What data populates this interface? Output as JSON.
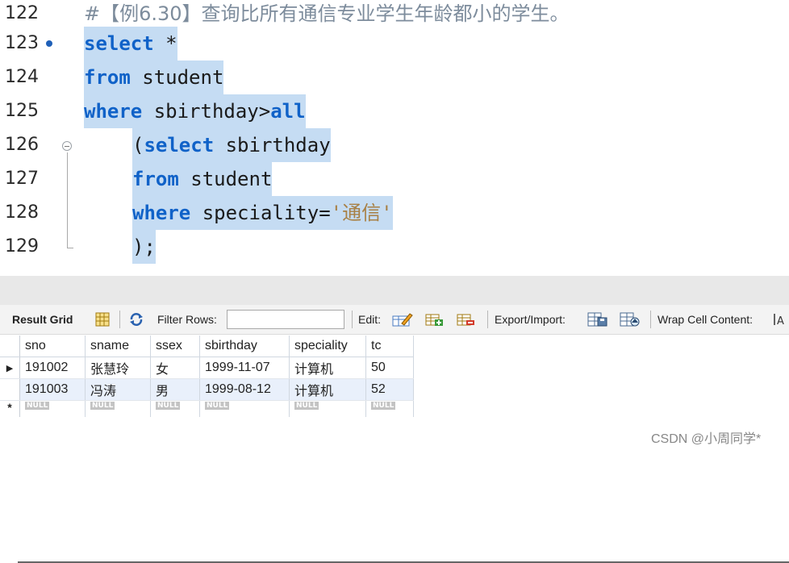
{
  "editor": {
    "lines": [
      {
        "num": "122",
        "parts": [
          {
            "t": "#【例6.30】查询比所有通信专业学生年龄都小的学生。",
            "c": "cm"
          }
        ]
      },
      {
        "num": "123",
        "marker": true,
        "parts": [
          {
            "t": "select",
            "c": "kw"
          },
          {
            "t": " *",
            "c": "tx"
          }
        ]
      },
      {
        "num": "124",
        "parts": [
          {
            "t": "from",
            "c": "kw"
          },
          {
            "t": " student",
            "c": "tx"
          }
        ]
      },
      {
        "num": "125",
        "parts": [
          {
            "t": "where",
            "c": "kw"
          },
          {
            "t": " sbirthday>",
            "c": "tx"
          },
          {
            "t": "all",
            "c": "kw"
          }
        ]
      },
      {
        "num": "126",
        "indent": true,
        "parts": [
          {
            "t": "(",
            "c": "tx"
          },
          {
            "t": "select",
            "c": "kw"
          },
          {
            "t": " sbirthday",
            "c": "tx"
          }
        ]
      },
      {
        "num": "127",
        "indent": true,
        "parts": [
          {
            "t": "from",
            "c": "kw"
          },
          {
            "t": " student",
            "c": "tx"
          }
        ]
      },
      {
        "num": "128",
        "indent": true,
        "parts": [
          {
            "t": "where",
            "c": "kw"
          },
          {
            "t": " speciality=",
            "c": "tx"
          },
          {
            "t": "'通信'",
            "c": "str"
          }
        ]
      },
      {
        "num": "129",
        "indent": true,
        "parts": [
          {
            "t": ");",
            "c": "tx"
          }
        ]
      }
    ]
  },
  "toolbar": {
    "result_grid": "Result Grid",
    "filter_rows": "Filter Rows:",
    "edit": "Edit:",
    "export_import": "Export/Import:",
    "wrap_cell": "Wrap Cell Content:"
  },
  "grid": {
    "columns": [
      "sno",
      "sname",
      "ssex",
      "sbirthday",
      "speciality",
      "tc"
    ],
    "rows": [
      [
        "191002",
        "张慧玲",
        "女",
        "1999-11-07",
        "计算机",
        "50"
      ],
      [
        "191003",
        "冯涛",
        "男",
        "1999-08-12",
        "计算机",
        "52"
      ]
    ],
    "null_label": "NULL",
    "current_row_marker": "▶",
    "new_row_marker": "*"
  },
  "watermark": "CSDN @小周同学*"
}
